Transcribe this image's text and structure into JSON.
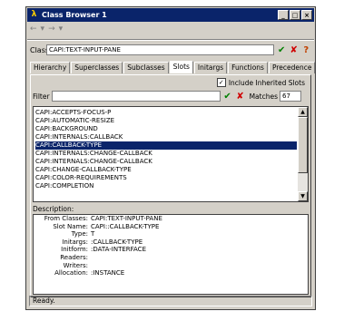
{
  "window": {
    "title": "Class Browser 1",
    "minimize_label": "_",
    "maximize_label": "□",
    "close_label": "×"
  },
  "nav": {
    "back_label": "←",
    "forward_label": "→"
  },
  "class_field": {
    "label": "Class:",
    "value": "CAPI:TEXT-INPUT-PANE"
  },
  "tabs": [
    "Hierarchy",
    "Superclasses",
    "Subclasses",
    "Slots",
    "Initargs",
    "Functions",
    "Precedence"
  ],
  "slots_panel": {
    "include_inherited_label": "Include Inherited Slots",
    "include_inherited_checked": true,
    "filter_label": "Filter",
    "filter_value": "",
    "matches_label": "Matches",
    "matches_value": "67",
    "items": [
      "CAPI:ACCEPTS-FOCUS-P",
      "CAPI:AUTOMATIC-RESIZE",
      "CAPI:BACKGROUND",
      "CAPI:INTERNALS:CALLBACK",
      "CAPI:CALLBACK-TYPE",
      "CAPI:INTERNALS:CHANGE-CALLBACK",
      "CAPI:INTERNALS:CHANGE-CALLBACK",
      "CAPI:CHANGE-CALLBACK-TYPE",
      "CAPI:COLOR-REQUIREMENTS",
      "CAPI:COMPLETION"
    ],
    "selected_index": 4,
    "description_label": "Description:",
    "description": [
      {
        "key": "From Classes:",
        "value": "CAPI:TEXT-INPUT-PANE"
      },
      {
        "key": "Slot Name:",
        "value": "CAPI::CALLBACK-TYPE"
      },
      {
        "key": "Type:",
        "value": "T"
      },
      {
        "key": "Initargs:",
        "value": ":CALLBACK-TYPE"
      },
      {
        "key": "Initform:",
        "value": ":DATA-INTERFACE"
      },
      {
        "key": "Readers:",
        "value": ""
      },
      {
        "key": "Writers:",
        "value": ""
      },
      {
        "key": "Allocation:",
        "value": ":INSTANCE"
      }
    ]
  },
  "status": "Ready."
}
